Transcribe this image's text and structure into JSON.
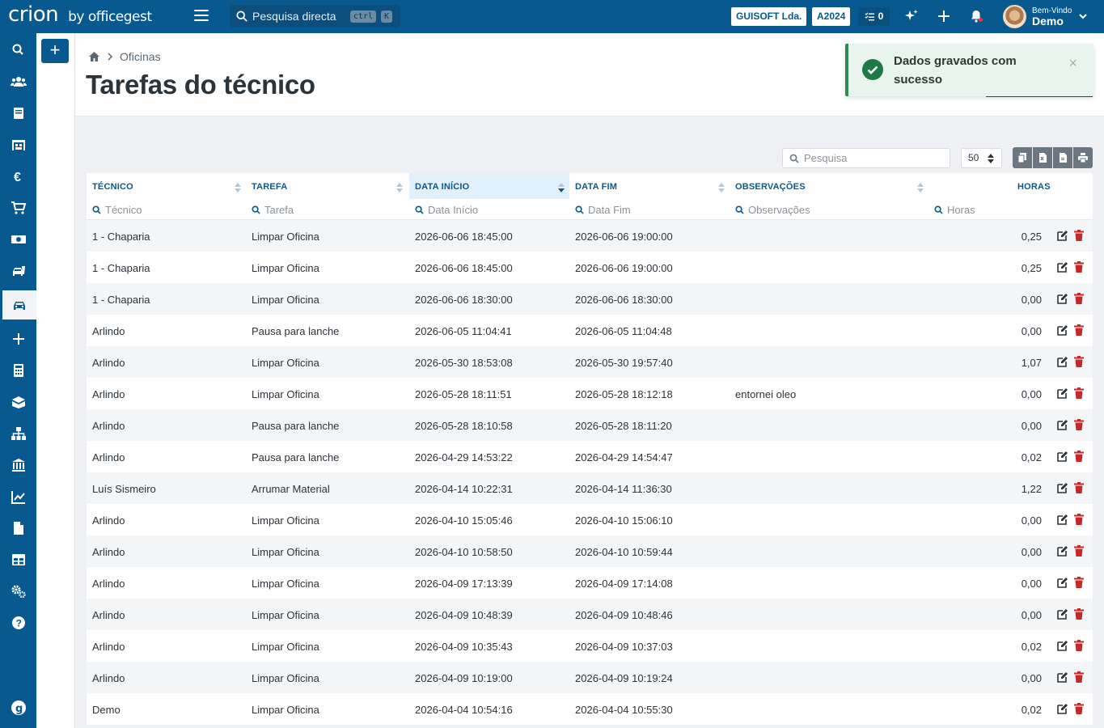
{
  "topbar": {
    "brand": "crion",
    "brand_suffix": "by officegest",
    "search_placeholder": "Pesquisa directa",
    "kbd_ctrl": "ctrl",
    "kbd_k": "K",
    "company": "GUISOFT Lda.",
    "year": "A2024",
    "tasks_count": "0",
    "welcome_small": "Bem-Vindo",
    "welcome_name": "Demo"
  },
  "sidebar": {
    "items": [
      "search-icon",
      "users-icon",
      "book-icon",
      "warehouse-icon",
      "euro-icon",
      "cart-icon",
      "money-icon",
      "car-wash-icon",
      "car-icon",
      "plus-icon",
      "calculator-icon",
      "boxes-icon",
      "sitemap-icon",
      "bank-icon",
      "chart-icon",
      "document-icon",
      "table-icon",
      "settings-icon",
      "help-icon"
    ],
    "active": "car-icon"
  },
  "header": {
    "breadcrumb": "Oficinas",
    "title": "Tarefas do técnico"
  },
  "toast": {
    "message": "Dados gravados com sucesso",
    "close": "×"
  },
  "table": {
    "search_placeholder": "Pesquisa",
    "page_size": "50",
    "columns": [
      {
        "label": "TÉCNICO",
        "filter": "Técnico"
      },
      {
        "label": "TAREFA",
        "filter": "Tarefa"
      },
      {
        "label": "DATA INÍCIO",
        "filter": "Data Início"
      },
      {
        "label": "DATA FIM",
        "filter": "Data Fim"
      },
      {
        "label": "OBSERVAÇÕES",
        "filter": "Observações"
      },
      {
        "label": "HORAS",
        "filter": "Horas"
      }
    ],
    "rows": [
      {
        "tecnico": "1 - Chaparia",
        "tarefa": "Limpar Oficina",
        "inicio": "2026-06-06 18:45:00",
        "fim": "2026-06-06 19:00:00",
        "obs": "",
        "horas": "0,25"
      },
      {
        "tecnico": "1 - Chaparia",
        "tarefa": "Limpar Oficina",
        "inicio": "2026-06-06 18:45:00",
        "fim": "2026-06-06 19:00:00",
        "obs": "",
        "horas": "0,25"
      },
      {
        "tecnico": "1 - Chaparia",
        "tarefa": "Limpar Oficina",
        "inicio": "2026-06-06 18:30:00",
        "fim": "2026-06-06 18:30:00",
        "obs": "",
        "horas": "0,00"
      },
      {
        "tecnico": "Arlindo",
        "tarefa": "Pausa para lanche",
        "inicio": "2026-06-05 11:04:41",
        "fim": "2026-06-05 11:04:48",
        "obs": "",
        "horas": "0,00"
      },
      {
        "tecnico": "Arlindo",
        "tarefa": "Limpar Oficina",
        "inicio": "2026-05-30 18:53:08",
        "fim": "2026-05-30 19:57:40",
        "obs": "",
        "horas": "1,07"
      },
      {
        "tecnico": "Arlindo",
        "tarefa": "Limpar Oficina",
        "inicio": "2026-05-28 18:11:51",
        "fim": "2026-05-28 18:12:18",
        "obs": "entornei oleo",
        "horas": "0,00"
      },
      {
        "tecnico": "Arlindo",
        "tarefa": "Pausa para lanche",
        "inicio": "2026-05-28 18:10:58",
        "fim": "2026-05-28 18:11:20",
        "obs": "",
        "horas": "0,00"
      },
      {
        "tecnico": "Arlindo",
        "tarefa": "Pausa para lanche",
        "inicio": "2026-04-29 14:53:22",
        "fim": "2026-04-29 14:54:47",
        "obs": "",
        "horas": "0,02"
      },
      {
        "tecnico": "Luís Sismeiro",
        "tarefa": "Arrumar Material",
        "inicio": "2026-04-14 10:22:31",
        "fim": "2026-04-14 11:36:30",
        "obs": "",
        "horas": "1,22"
      },
      {
        "tecnico": "Arlindo",
        "tarefa": "Limpar Oficina",
        "inicio": "2026-04-10 15:05:46",
        "fim": "2026-04-10 15:06:10",
        "obs": "",
        "horas": "0,00"
      },
      {
        "tecnico": "Arlindo",
        "tarefa": "Limpar Oficina",
        "inicio": "2026-04-10 10:58:50",
        "fim": "2026-04-10 10:59:44",
        "obs": "",
        "horas": "0,00"
      },
      {
        "tecnico": "Arlindo",
        "tarefa": "Limpar Oficina",
        "inicio": "2026-04-09 17:13:39",
        "fim": "2026-04-09 17:14:08",
        "obs": "",
        "horas": "0,00"
      },
      {
        "tecnico": "Arlindo",
        "tarefa": "Limpar Oficina",
        "inicio": "2026-04-09 10:48:39",
        "fim": "2026-04-09 10:48:46",
        "obs": "",
        "horas": "0,00"
      },
      {
        "tecnico": "Arlindo",
        "tarefa": "Limpar Oficina",
        "inicio": "2026-04-09 10:35:43",
        "fim": "2026-04-09 10:37:03",
        "obs": "",
        "horas": "0,02"
      },
      {
        "tecnico": "Arlindo",
        "tarefa": "Limpar Oficina",
        "inicio": "2026-04-09 10:19:00",
        "fim": "2026-04-09 10:19:24",
        "obs": "",
        "horas": "0,00"
      },
      {
        "tecnico": "Demo",
        "tarefa": "Limpar Oficina",
        "inicio": "2026-04-04 10:54:16",
        "fim": "2026-04-04 10:55:30",
        "obs": "",
        "horas": "0,02"
      }
    ]
  },
  "colors": {
    "primary": "#08598f",
    "success": "#1e7a45",
    "danger": "#c62828"
  }
}
